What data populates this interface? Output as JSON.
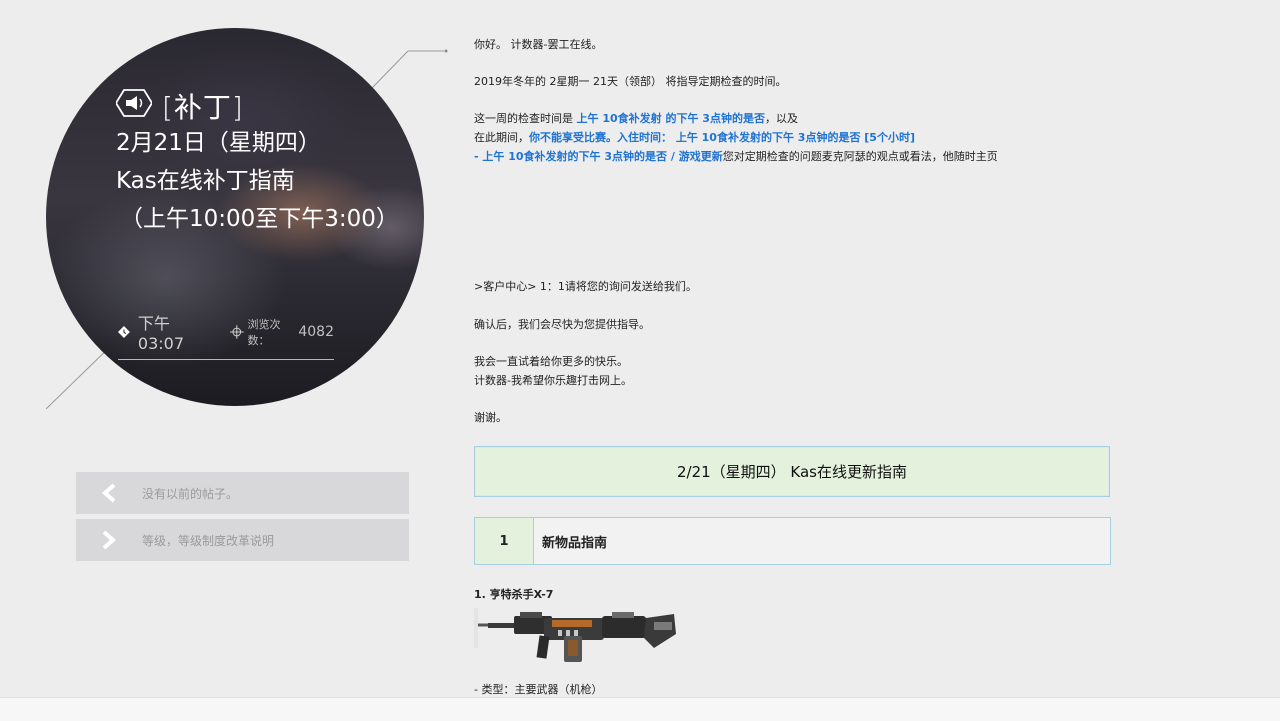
{
  "hero": {
    "tag": "[补丁]",
    "date": "2月21日（星期四）",
    "title": "Kas在线补丁指南",
    "time_range": "（上午10:00至下午3:00）",
    "post_time": "下午03:07",
    "views_label": "浏览次数：",
    "views_count": "4082"
  },
  "nav": {
    "prev_label": "没有以前的帖子。",
    "next_label": "等级，等级制度改革说明"
  },
  "article": {
    "greeting": "你好。 计数器-罢工在线。",
    "schedule_intro": "2019年冬年的 2星期一 21天（领部） 将指导定期检查的时间。",
    "line1_a": "这一周的检查时间是 ",
    "line1_b": "上午 10食补发射 的下午 3点钟的是否",
    "line1_c": "，以及",
    "line2_a": "在此期间，",
    "line2_b": "你不能享受比赛。入住时间： 上午 10食补发射的下午 3点钟的是否 [5个小时]",
    "line3_a": "- 上午 10食补发射的下午 3点钟的是否 / 游戏更新",
    "line3_b": "您对定期检查的问题麦克阿瑟的观点或看法，他随时主页",
    "support": ">客户中心> 1：1请将您的询问发送给我们。",
    "confirm": "确认后，我们会尽快为您提供指导。",
    "fun": "我会一直试着给你更多的快乐。",
    "wish": "计数器-我希望你乐趣打击网上。",
    "thanks": "谢谢。",
    "banner": "2/21（星期四） Kas在线更新指南",
    "section_num": "1",
    "section_title": "新物品指南",
    "item_title": "1. 亨特杀手X-7",
    "item_type": "- 类型：主要武器（机枪）"
  },
  "colors": {
    "highlight_blue": "#1f73d2",
    "banner_green": "#e3f1dd",
    "border_blue": "#a8cfe0"
  }
}
